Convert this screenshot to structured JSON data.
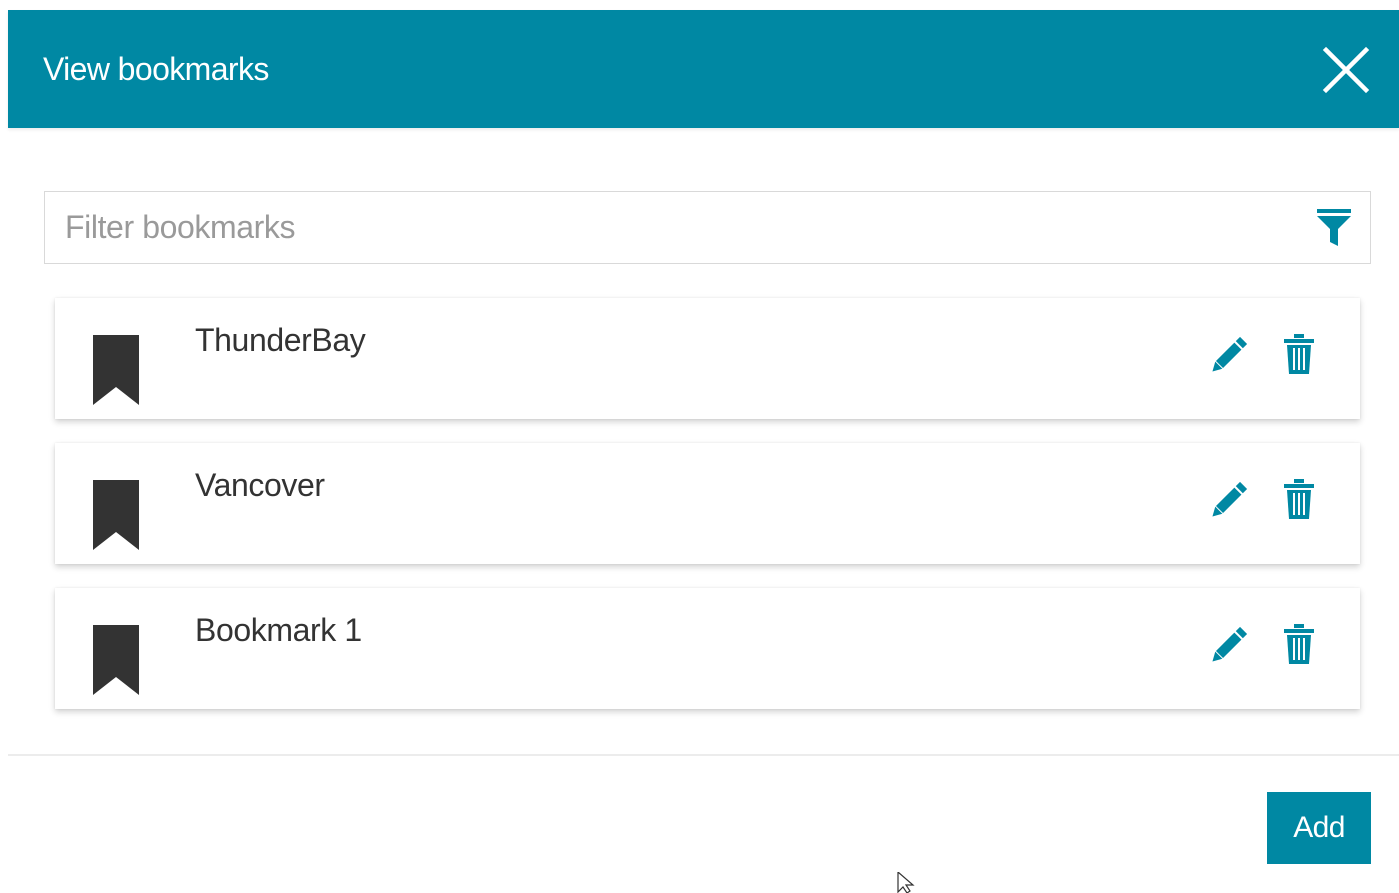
{
  "dialog": {
    "title": "View bookmarks",
    "close_icon": "close-icon"
  },
  "filter": {
    "placeholder": "Filter bookmarks",
    "value": "",
    "icon": "filter-funnel-icon"
  },
  "bookmarks": [
    {
      "name": "ThunderBay",
      "icon": "bookmark-icon",
      "edit_icon": "pencil-icon",
      "delete_icon": "trash-icon"
    },
    {
      "name": "Vancover",
      "icon": "bookmark-icon",
      "edit_icon": "pencil-icon",
      "delete_icon": "trash-icon"
    },
    {
      "name": "Bookmark 1",
      "icon": "bookmark-icon",
      "edit_icon": "pencil-icon",
      "delete_icon": "trash-icon"
    }
  ],
  "footer": {
    "add_label": "Add"
  },
  "colors": {
    "accent": "#0088a3",
    "text": "#333333",
    "bookmark_icon": "#333333"
  }
}
